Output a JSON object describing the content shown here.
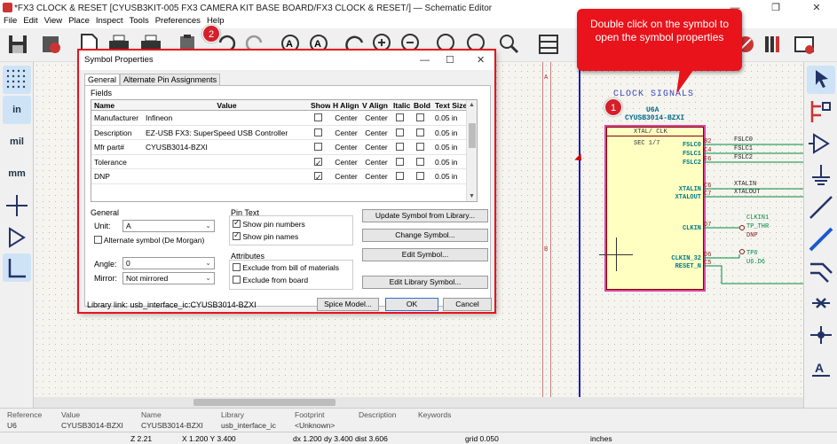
{
  "window": {
    "title": "*FX3 CLOCK & RESET [CYUSB3KIT-005 FX3 CAMERA KIT BASE BOARD/FX3 CLOCK & RESET/] — Schematic Editor"
  },
  "menu": [
    "File",
    "Edit",
    "View",
    "Place",
    "Inspect",
    "Tools",
    "Preferences",
    "Help"
  ],
  "left_toolbar": {
    "items": [
      {
        "icon": "grid-icon",
        "label": ""
      },
      {
        "icon": "inch-units-icon",
        "label": "in"
      },
      {
        "icon": "mil-units-icon",
        "label": "mil"
      },
      {
        "icon": "mm-units-icon",
        "label": "mm"
      },
      {
        "icon": "cursor-crosshair-icon",
        "label": ""
      },
      {
        "icon": "pin-type-icon",
        "label": ""
      },
      {
        "icon": "orthogonal-line-icon",
        "label": ""
      }
    ]
  },
  "callout": {
    "text": "Double click on the symbol to open the symbol properties",
    "color": "#e8131b"
  },
  "badges": [
    "1",
    "2"
  ],
  "dialog": {
    "title": "Symbol Properties",
    "tabs": [
      "General",
      "Alternate Pin Assignments"
    ],
    "fields_label": "Fields",
    "columns": [
      "Name",
      "Value",
      "Show",
      "H Align",
      "V Align",
      "Italic",
      "Bold",
      "Text Size"
    ],
    "rows": [
      {
        "name": "Manufacturer",
        "value": "Infineon",
        "show": false,
        "halign": "Center",
        "valign": "Center",
        "size": "0.05 in"
      },
      {
        "name": "Description",
        "value": "EZ-USB FX3: SuperSpeed USB Controller",
        "show": false,
        "halign": "Center",
        "valign": "Center",
        "size": "0.05 in"
      },
      {
        "name": "Mfr part#",
        "value": "CYUSB3014-BZXI",
        "show": false,
        "halign": "Center",
        "valign": "Center",
        "size": "0.05 in"
      },
      {
        "name": "Tolerance",
        "value": "",
        "show": true,
        "halign": "Center",
        "valign": "Center",
        "size": "0.05 in"
      },
      {
        "name": "DNP",
        "value": "",
        "show": true,
        "halign": "Center",
        "valign": "Center",
        "size": "0.05 in"
      }
    ],
    "general": {
      "label": "General",
      "unit_label": "Unit:",
      "unit_value": "A",
      "alt_symbol": "Alternate symbol (De Morgan)",
      "angle_label": "Angle:",
      "angle_value": "0",
      "mirror_label": "Mirror:",
      "mirror_value": "Not mirrored"
    },
    "pin_text": {
      "label": "Pin Text",
      "show_numbers": "Show pin numbers",
      "show_names": "Show pin names"
    },
    "attributes": {
      "label": "Attributes",
      "exclude_bom": "Exclude from bill of materials",
      "exclude_board": "Exclude from board"
    },
    "buttons": {
      "update": "Update Symbol from Library...",
      "change": "Change Symbol...",
      "edit": "Edit Symbol...",
      "edit_lib": "Edit Library Symbol...",
      "spice": "Spice Model...",
      "ok": "OK",
      "cancel": "Cancel"
    },
    "library_link": "Library link:  usb_interface_ic:CYUSB3014-BZXI"
  },
  "schematic": {
    "section_title": "CLOCK SIGNALS",
    "ref": "U6A",
    "part": "CYUSB3014-BZXI",
    "box_title": "XTAL/ CLK",
    "sec": "SEC 1/7",
    "border_labels": [
      "A",
      "B"
    ],
    "pins": [
      {
        "name": "FSLC0",
        "num": "B2",
        "net": "FSLC0"
      },
      {
        "name": "FSLC1",
        "num": "C4",
        "net": "FSLC1"
      },
      {
        "name": "FSLC2",
        "num": "E6",
        "net": "FSLC2"
      },
      {
        "name": "XTALIN",
        "num": "C6",
        "net": "XTALIN"
      },
      {
        "name": "XTALOUT",
        "num": "C7",
        "net": "XTALOUT"
      },
      {
        "name": "CLKIN",
        "num": "D7",
        "net": "CLKIN1"
      },
      {
        "name": "CLKIN_32",
        "num": "D6",
        "net": "TP6"
      },
      {
        "name": "RESET_N",
        "num": "C5",
        "net": ""
      }
    ],
    "tp_labels": [
      "TP_THR",
      "DNP",
      "U6.D6"
    ]
  },
  "status_info": {
    "headers": [
      "Reference",
      "Value",
      "Name",
      "Library",
      "Footprint",
      "Description",
      "Keywords"
    ],
    "values": [
      "U6",
      "CYUSB3014-BZXI",
      "CYUSB3014-BZXI",
      "usb_interface_ic",
      "<Unknown>",
      "",
      ""
    ]
  },
  "status_bar": {
    "zoom": "Z 2.21",
    "coords": "X 1.200  Y 3.400",
    "delta": "dx 1.200  dy 3.400  dist 3.606",
    "grid": "grid 0.050",
    "units": "inches"
  },
  "colors": {
    "symbol_fill": "#ffffc2",
    "symbol_border": "#840000",
    "accent_red": "#e8131b",
    "wire_green": "#008c3c",
    "bus_blue": "#1a1acc"
  }
}
